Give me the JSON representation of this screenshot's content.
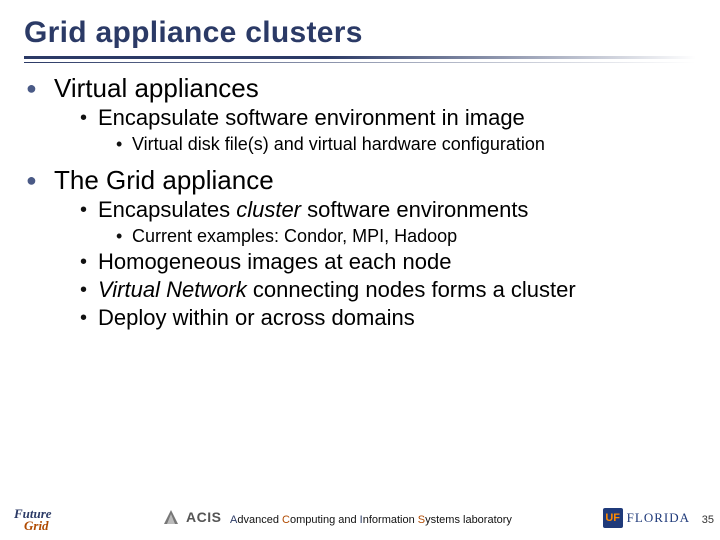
{
  "title": "Grid appliance clusters",
  "sections": [
    {
      "heading": "Virtual appliances",
      "level2": [
        {
          "text": "Encapsulate software environment in image",
          "level3": [
            "Virtual disk file(s) and virtual hardware configuration"
          ]
        }
      ]
    },
    {
      "heading": "The Grid appliance",
      "level2": [
        {
          "text_parts": [
            "Encapsulates ",
            "cluster",
            " software environments"
          ],
          "level3": [
            "Current examples: Condor, MPI, Hadoop"
          ]
        },
        {
          "text": "Homogeneous images at each node"
        },
        {
          "text_parts": [
            "",
            "Virtual Network",
            " connecting nodes forms a cluster"
          ]
        },
        {
          "text": "Deploy within or across domains"
        }
      ]
    }
  ],
  "footer": {
    "futuregrid": {
      "line1": "Future",
      "line2": "Grid"
    },
    "acis": "ACIS",
    "lab_text": "Advanced Computing and Information Systems laboratory",
    "lab_letters": {
      "A": "A",
      "C": "C",
      "I": "I",
      "S": "S"
    },
    "uf_box": "UF",
    "uf_text": "FLORIDA",
    "page": "35"
  }
}
